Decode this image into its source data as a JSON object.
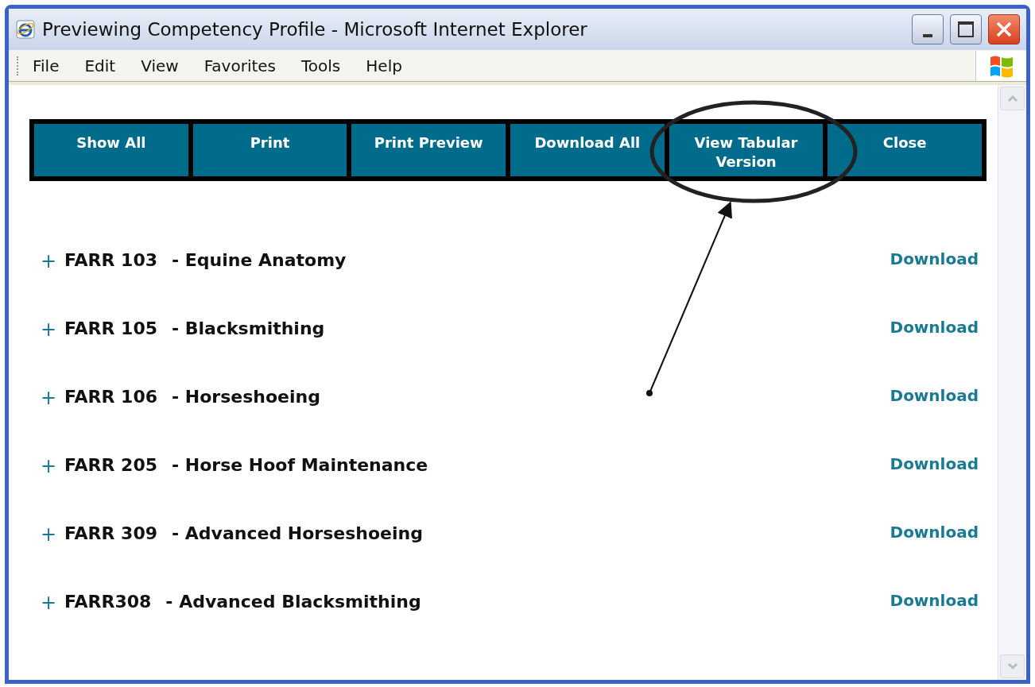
{
  "window": {
    "title": "Previewing Competency Profile - Microsoft Internet Explorer"
  },
  "menu": [
    "File",
    "Edit",
    "View",
    "Favorites",
    "Tools",
    "Help"
  ],
  "toolbar": [
    {
      "label": "Show All"
    },
    {
      "label": "Print"
    },
    {
      "label": "Print Preview"
    },
    {
      "label": "Download All"
    },
    {
      "label": "View Tabular Version"
    },
    {
      "label": "Close"
    }
  ],
  "courses": [
    {
      "code": "FARR 103",
      "title": "- Equine Anatomy",
      "expander": "+",
      "link": "Download"
    },
    {
      "code": "FARR 105",
      "title": "- Blacksmithing",
      "expander": "+",
      "link": "Download"
    },
    {
      "code": "FARR 106",
      "title": "- Horseshoeing",
      "expander": "+",
      "link": "Download"
    },
    {
      "code": "FARR 205",
      "title": "- Horse Hoof Maintenance",
      "expander": "+",
      "link": "Download"
    },
    {
      "code": "FARR 309",
      "title": "- Advanced Horseshoeing",
      "expander": "+",
      "link": "Download"
    },
    {
      "code": "FARR308",
      "title": "- Advanced Blacksmithing",
      "expander": "+",
      "link": "Download"
    }
  ]
}
